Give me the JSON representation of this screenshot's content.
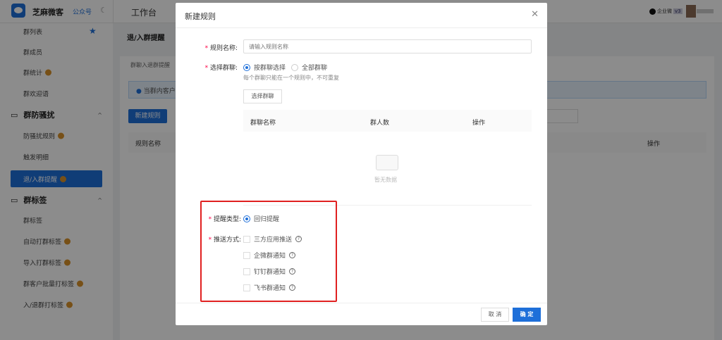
{
  "topbar": {
    "brand": "芝麻微客",
    "gzh": "公众号",
    "workbench": "工作台",
    "enterprise": "企业微",
    "version": "v3"
  },
  "sidebar": {
    "items": [
      {
        "label": "群列表",
        "starred": true
      },
      {
        "label": "群成员"
      },
      {
        "label": "群统计",
        "premium": true
      },
      {
        "label": "群欢迎语"
      },
      {
        "group": "群防骚扰"
      },
      {
        "label": "防骚扰规则",
        "premium": true
      },
      {
        "label": "触发明细"
      },
      {
        "label": "退/入群提醒",
        "premium": true,
        "active": true
      },
      {
        "group": "群标签"
      },
      {
        "label": "群标签"
      },
      {
        "label": "自动打群标签",
        "premium": true
      },
      {
        "label": "导入打群标签",
        "premium": true
      },
      {
        "label": "群客户批量打标签",
        "premium": true
      },
      {
        "label": "入/退群打标签",
        "premium": true
      }
    ]
  },
  "main": {
    "title": "退/入群提醒",
    "tab": "群聊入退群提醒",
    "alert": "当群内客户",
    "new_rule": "新建规则",
    "columns": [
      "规则名称",
      "操作"
    ]
  },
  "modal": {
    "title": "新建规则",
    "rule_name_label": "规则名称:",
    "rule_name_placeholder": "请输入规则名称",
    "select_group_label": "选择群聊:",
    "opt_by_group": "按群聊选择",
    "opt_all": "全部群聊",
    "hint": "每个群聊只能在一个规则中，不可重复",
    "select_group_btn": "选择群聊",
    "columns": [
      "群聊名称",
      "群人数",
      "操作"
    ],
    "empty": "暂无数据",
    "remind_type_label": "提醒类型:",
    "remind_type": "回归提醒",
    "push_label": "推送方式:",
    "push_options": [
      "三方应用推送",
      "企微群通知",
      "钉钉群通知",
      "飞书群通知"
    ],
    "cancel": "取 消",
    "ok": "确 定"
  },
  "colors": {
    "primary": "#1e6fd9",
    "highlight_box": "#e02020"
  }
}
